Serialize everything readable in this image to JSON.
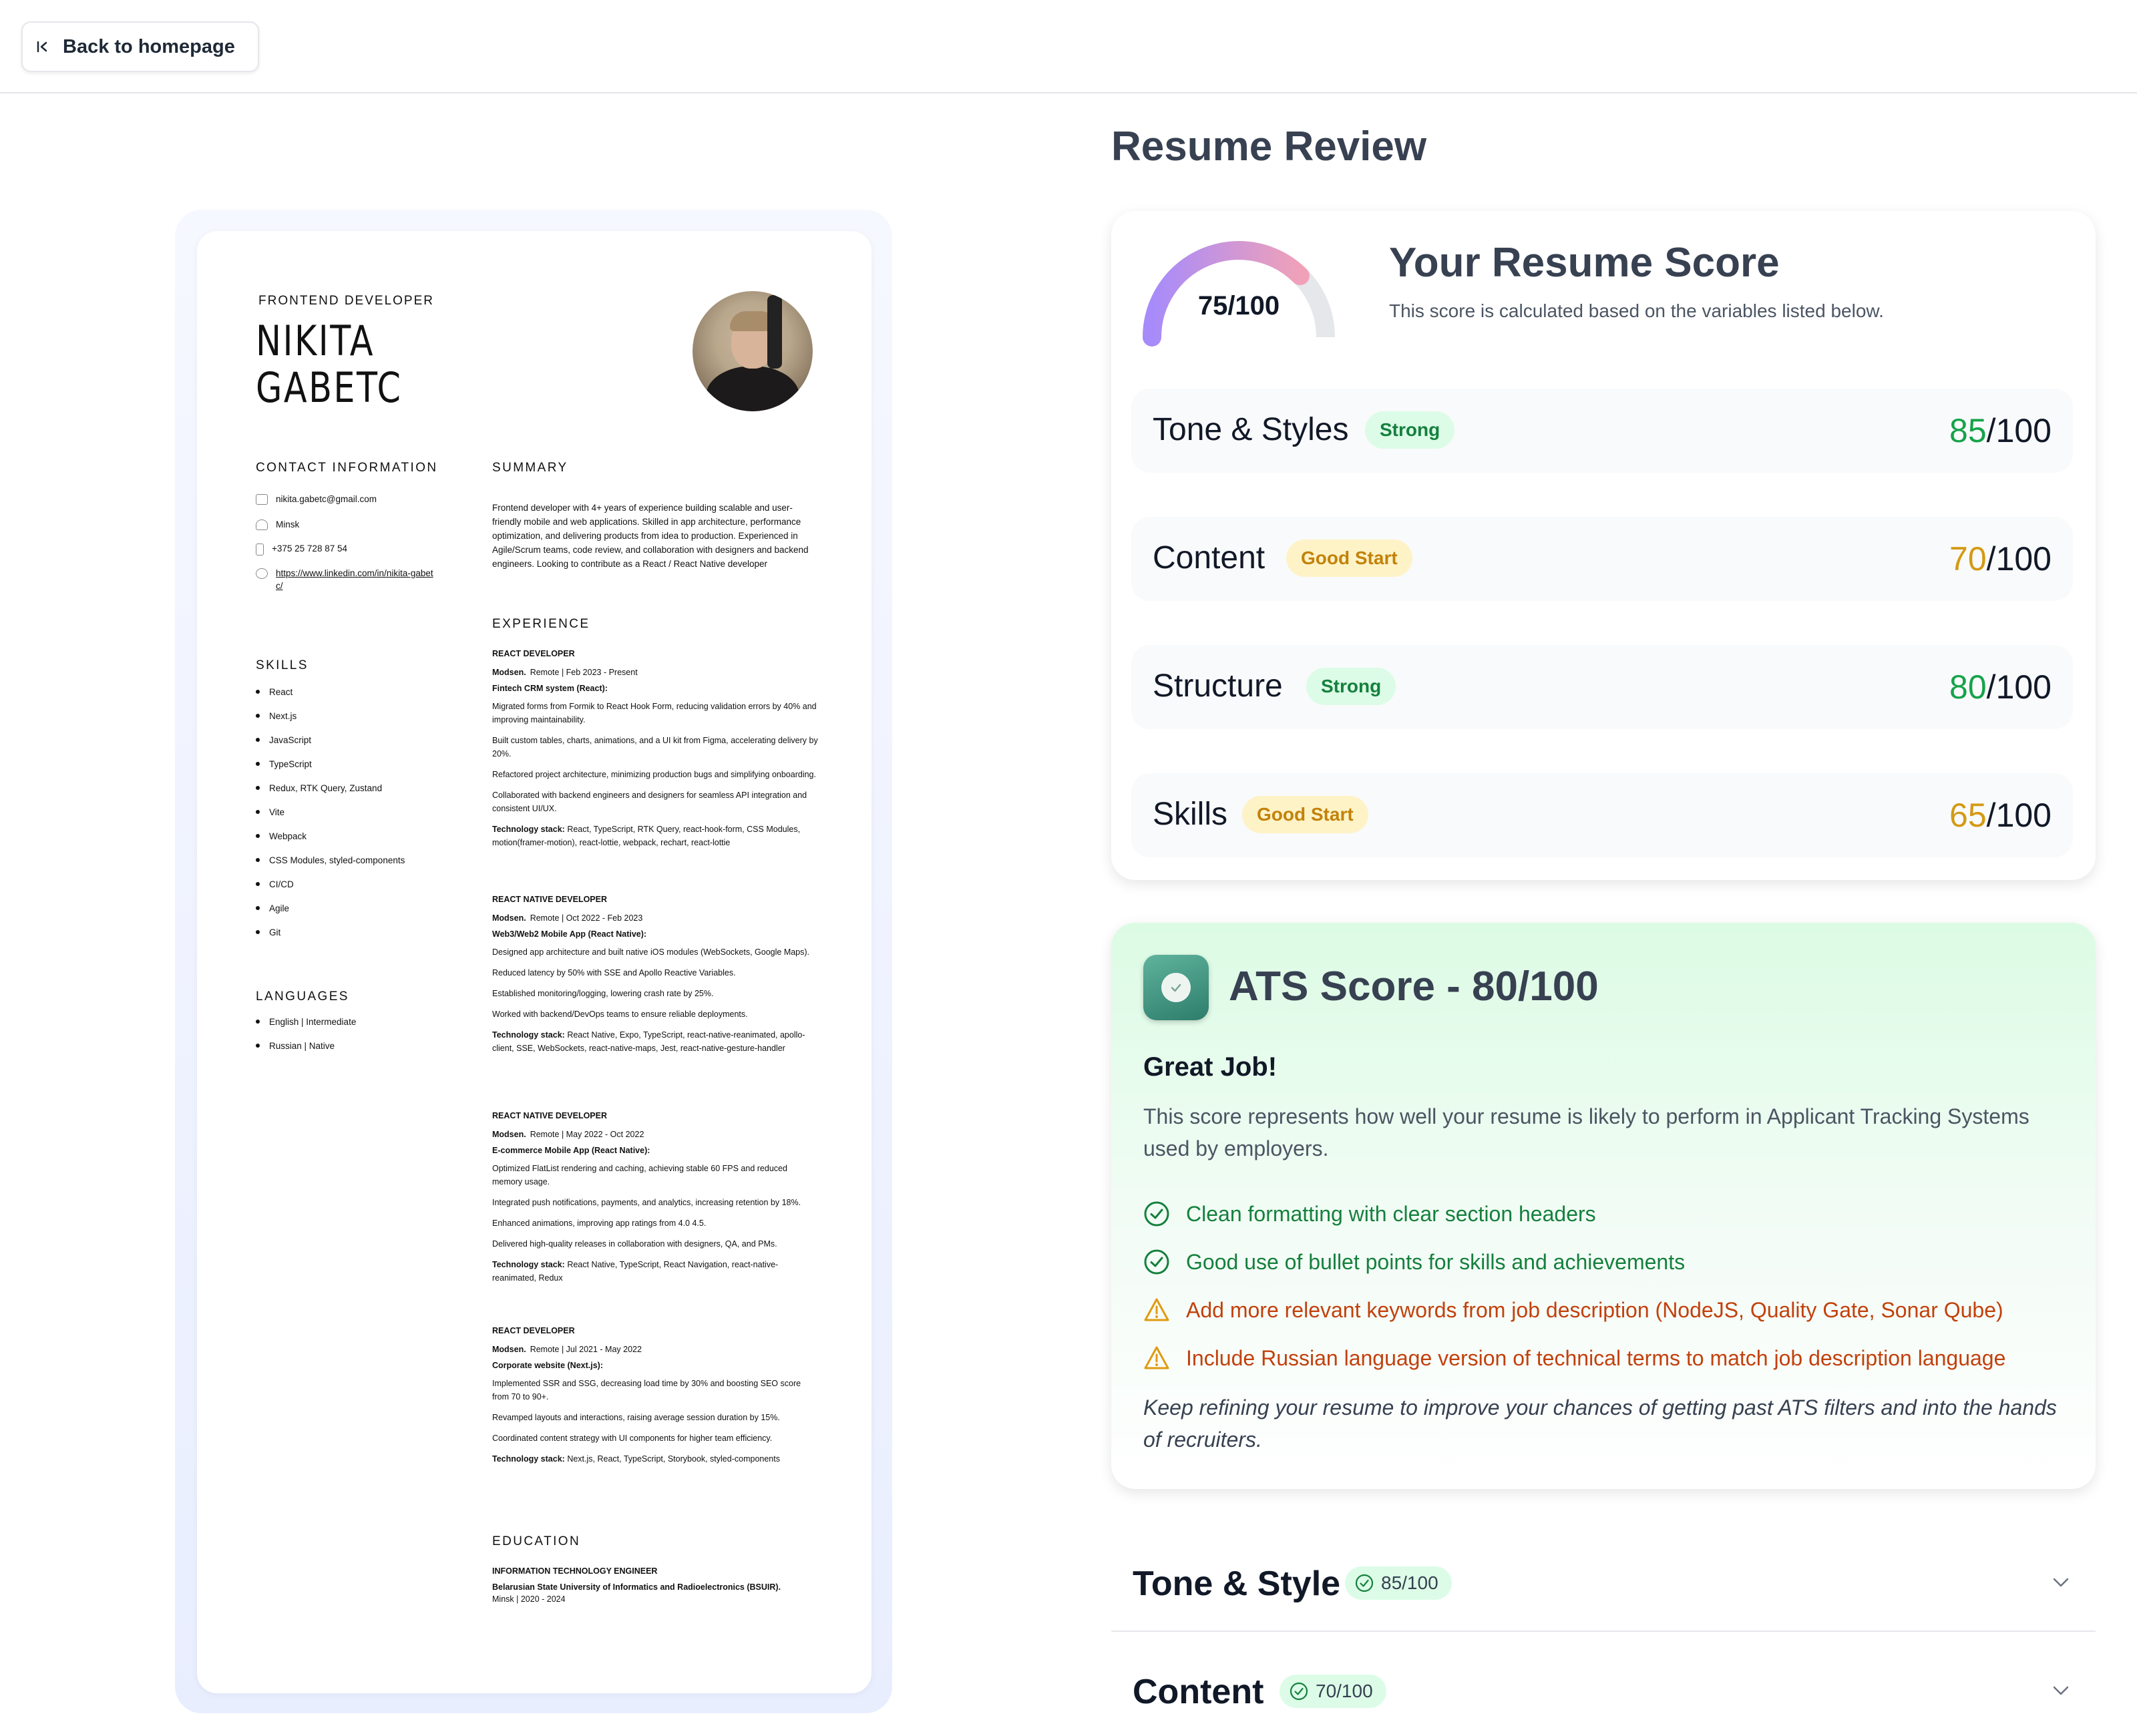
{
  "nav": {
    "back_label": "Back to homepage"
  },
  "resume": {
    "role": "FRONTEND DEVELOPER",
    "name_line1": "NIKITA",
    "name_line2": "GABETC",
    "contact_heading": "CONTACT INFORMATION",
    "contact": {
      "email": "nikita.gabetc@gmail.com",
      "city": "Minsk",
      "phone": "+375 25 728 87 54",
      "linkedin": "https://www.linkedin.com/in/nikita-gabetc/"
    },
    "skills_heading": "SKILLS",
    "skills": [
      "React",
      "Next.js",
      "JavaScript",
      "TypeScript",
      "Redux, RTK Query, Zustand",
      "Vite",
      "Webpack",
      "CSS Modules, styled-components",
      "CI/CD",
      "Agile",
      "Git"
    ],
    "languages_heading": "LANGUAGES",
    "languages": [
      "English | Intermediate",
      "Russian | Native"
    ],
    "summary_heading": "SUMMARY",
    "summary": "Frontend developer with 4+ years of experience building scalable and user-friendly mobile and web applications. Skilled in app architecture, performance optimization, and delivering products from idea to production. Experienced in Agile/Scrum teams, code review, and collaboration with designers and backend engineers. Looking to contribute as a React / React Native developer",
    "experience_heading": "EXPERIENCE",
    "experience": [
      {
        "title": "REACT DEVELOPER",
        "company": "Modsen.",
        "meta": "Remote | Feb 2023 - Present",
        "project": "Fintech CRM system (React):",
        "bullets": [
          "Migrated forms from Formik to React Hook Form, reducing validation errors by 40% and improving maintainability.",
          "Built custom tables, charts, animations, and a UI kit from Figma, accelerating delivery by 20%.",
          "Refactored project architecture, minimizing production bugs and simplifying onboarding.",
          "Collaborated with backend engineers and designers for seamless API integration and consistent UI/UX."
        ],
        "stack_label": "Technology stack:",
        "stack": "React, TypeScript, RTK Query, react-hook-form, CSS Modules, motion(framer-motion), react-lottie, webpack, rechart, react-lottie"
      },
      {
        "title": "REACT NATIVE DEVELOPER",
        "company": "Modsen.",
        "meta": "Remote | Oct 2022 - Feb 2023",
        "project": "Web3/Web2 Mobile App (React Native):",
        "bullets": [
          "Designed app architecture and built native iOS modules (WebSockets, Google Maps).",
          "Reduced latency by 50% with SSE and Apollo Reactive Variables.",
          "Established monitoring/logging, lowering crash rate by 25%.",
          "Worked with backend/DevOps teams to ensure reliable deployments."
        ],
        "stack_label": "Technology stack:",
        "stack": "React Native, Expo, TypeScript, react-native-reanimated, apollo-client, SSE, WebSockets, react-native-maps, Jest, react-native-gesture-handler"
      },
      {
        "title": "REACT NATIVE DEVELOPER",
        "company": "Modsen.",
        "meta": "Remote | May 2022 - Oct 2022",
        "project": "E-commerce Mobile App (React Native):",
        "bullets": [
          "Optimized FlatList rendering and caching, achieving stable 60 FPS and reduced memory usage.",
          "Integrated push notifications, payments, and analytics, increasing retention by 18%.",
          "Enhanced animations, improving app ratings from 4.0 4.5.",
          "Delivered high-quality releases in collaboration with designers, QA, and PMs."
        ],
        "stack_label": "Technology stack:",
        "stack": "React Native, TypeScript, React Navigation, react-native-reanimated, Redux"
      },
      {
        "title": "REACT DEVELOPER",
        "company": "Modsen.",
        "meta": "Remote | Jul 2021 - May 2022",
        "project": "Corporate website (Next.js):",
        "bullets": [
          "Implemented SSR and SSG, decreasing load time by 30% and boosting SEO score from 70 to 90+.",
          "Revamped layouts and interactions, raising average session duration by 15%.",
          "Coordinated content strategy with UI components for higher team efficiency."
        ],
        "stack_label": "Technology stack:",
        "stack": "Next.js, React, TypeScript, Storybook, styled-components"
      }
    ],
    "education_heading": "EDUCATION",
    "education": {
      "degree": "INFORMATION TECHNOLOGY ENGINEER",
      "school": "Belarusian State University of Informatics and Radioelectronics (BSUIR).",
      "meta": "Minsk | 2020 - 2024"
    }
  },
  "review": {
    "title": "Resume Review",
    "score_card": {
      "gauge_value": 75,
      "gauge_max": 100,
      "gauge_text": "75/100",
      "title": "Your Resume Score",
      "subtitle": "This score is calculated based on the variables listed below.",
      "categories": [
        {
          "name": "Tone & Styles",
          "badge": "Strong",
          "score": "85",
          "max": "/100",
          "tone": "green"
        },
        {
          "name": "Content",
          "badge": "Good Start",
          "score": "70",
          "max": "/100",
          "tone": "amber"
        },
        {
          "name": "Structure",
          "badge": "Strong",
          "score": "80",
          "max": "/100",
          "tone": "green"
        },
        {
          "name": "Skills",
          "badge": "Good Start",
          "score": "65",
          "max": "/100",
          "tone": "amber"
        }
      ]
    },
    "ats": {
      "title": "ATS Score - 80/100",
      "heading": "Great Job!",
      "description": "This score represents how well your resume is likely to perform in Applicant Tracking Systems used by employers.",
      "items": [
        {
          "type": "good",
          "icon": "check-circle-icon",
          "text": "Clean formatting with clear section headers"
        },
        {
          "type": "good",
          "icon": "check-circle-icon",
          "text": "Good use of bullet points for skills and achievements"
        },
        {
          "type": "warn",
          "icon": "warning-icon",
          "text": "Add more relevant keywords from job description (NodeJS, Quality Gate, Sonar Qube)"
        },
        {
          "type": "warn",
          "icon": "warning-icon",
          "text": "Include Russian language version of technical terms to match job description language"
        }
      ],
      "footer": "Keep refining your resume to improve your chances of getting past ATS filters and into the hands of recruiters."
    },
    "accordions": [
      {
        "title": "Tone & Style",
        "score": "85/100"
      },
      {
        "title": "Content",
        "score": "70/100"
      }
    ]
  },
  "colors": {
    "green": "#16a34a",
    "amber": "#d49a14",
    "gauge_start": "#a78bfa",
    "gauge_end": "#f0a1b8",
    "gauge_track": "#e5e7eb"
  }
}
